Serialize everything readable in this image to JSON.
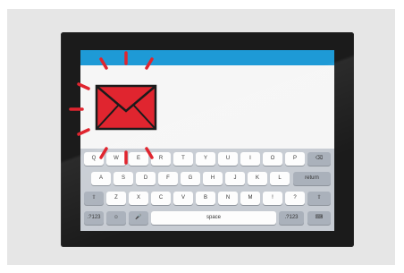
{
  "keyboard": {
    "row1": [
      "Q",
      "W",
      "E",
      "R",
      "T",
      "Y",
      "U",
      "I",
      "O",
      "P"
    ],
    "row2": [
      "A",
      "S",
      "D",
      "F",
      "G",
      "H",
      "J",
      "K",
      "L"
    ],
    "row3": [
      "Z",
      "X",
      "C",
      "V",
      "B",
      "N",
      "M",
      "!",
      "?"
    ],
    "backspace_symbol": "⌫",
    "return_label": "return",
    "shift_symbol": "⇧",
    "numbers_label": ".?123",
    "globe_symbol": "☺",
    "mic_symbol": "🎤",
    "space_label": "space",
    "hide_symbol": "⌨"
  },
  "colors": {
    "accent": "#1e9ad6",
    "alert": "#e0252f",
    "bezel": "#1b1b1b"
  },
  "icons": [
    "envelope-icon",
    "alert-burst-icon"
  ]
}
